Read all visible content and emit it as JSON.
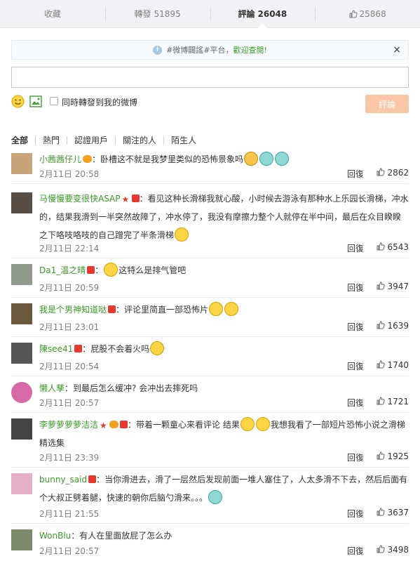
{
  "tabs": [
    {
      "label": "收藏",
      "count": ""
    },
    {
      "label": "轉發",
      "count": "51895"
    },
    {
      "label": "評論",
      "count": "26048"
    },
    {
      "label": "",
      "count": "25868"
    }
  ],
  "notice": {
    "text": "#微博闢謠#平台，",
    "link": "歡迎查閱!",
    "close": "×"
  },
  "composer": {
    "placeholder": "",
    "repost_label": "同時轉發到我的微博",
    "submit_label": "評論"
  },
  "filters": [
    "全部",
    "熱門",
    "認證用戶",
    "關注的人",
    "陌生人"
  ],
  "reply_label": "回復",
  "comments": [
    {
      "user": "小茜茜仔儿",
      "text": "：卧槽这不就是我梦里类似的恐怖景象吗",
      "time": "2月11日 20:58",
      "likes": "2862",
      "avatar_color": "#c9a37a"
    },
    {
      "user": "马慢慢要变很快ASAP",
      "text": "：看见这种长滑梯我就心酸，小时候去游泳有那种水上乐园长滑梯，冲水的，结果我滑到一半突然故障了，冲水停了，我没有摩擦力整个人就停在半中间，最后在众目睽睽之下咯吱咯吱的自己蹭完了半条滑梯",
      "time": "2月11日 22:14",
      "likes": "6543",
      "avatar_color": "#5a4d44"
    },
    {
      "user": "Da1_温之晴",
      "text": "这特么是排气管吧",
      "time": "2月11日 20:59",
      "likes": "3947",
      "avatar_color": "#8f9a8a"
    },
    {
      "user": "我是个男神知道哒",
      "text": "：评论里简直一部恐怖片",
      "time": "2月11日 23:01",
      "likes": "1639",
      "avatar_color": "#6b5a3e"
    },
    {
      "user": "陳see41",
      "text": "：屁股不会着火吗",
      "time": "2月11日 20:54",
      "likes": "1740",
      "avatar_color": "#555555"
    },
    {
      "user": "懒人孳",
      "text": "：到最后怎么缓冲? 会冲出去摔死吗",
      "time": "2月11日 20:57",
      "likes": "1721",
      "avatar_color": "#d86aa8"
    },
    {
      "user": "李萝萝萝萝洁洁",
      "text": "：带着一颗童心来看评论 结果",
      "text2": "我想我看了一部短片恐怖小说之滑梯精选集",
      "time": "2月11日 23:39",
      "likes": "1925",
      "avatar_color": "#444444"
    },
    {
      "user": "bunny_said",
      "text": "：当你滑进去，滑了一层然后发现前面一堆人塞住了，人太多滑不下去，然后后面有个大叔正劈着腿，快速的朝你后脑勺滑来。。。",
      "time": "2月11日 21:55",
      "likes": "3637",
      "avatar_color": "#e3b0c8"
    },
    {
      "user": "WonBlu",
      "text": "：有人在里面放屁了怎么办",
      "time": "2月11日 20:57",
      "likes": "3498",
      "avatar_color": "#7a8a6a"
    }
  ]
}
